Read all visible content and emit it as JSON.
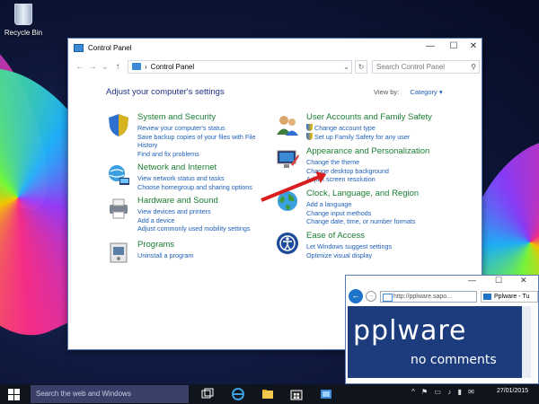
{
  "desktop": {
    "recycle_bin_label": "Recycle Bin"
  },
  "control_panel": {
    "window_title": "Control Panel",
    "address_path": "Control Panel",
    "search_placeholder": "Search Control Panel",
    "heading": "Adjust your computer's settings",
    "view_by_label": "View by:",
    "view_by_value": "Category",
    "categories": [
      {
        "title": "System and Security",
        "icon": "shield-icon",
        "links": [
          "Review your computer's status",
          "Save backup copies of your files with File History",
          "Find and fix problems"
        ]
      },
      {
        "title": "Network and Internet",
        "icon": "network-icon",
        "links": [
          "View network status and tasks",
          "Choose homegroup and sharing options"
        ]
      },
      {
        "title": "Hardware and Sound",
        "icon": "printer-icon",
        "links": [
          "View devices and printers",
          "Add a device",
          "Adjust commonly used mobility settings"
        ]
      },
      {
        "title": "Programs",
        "icon": "programs-icon",
        "links": [
          "Uninstall a program"
        ]
      },
      {
        "title": "User Accounts and Family Safety",
        "icon": "users-icon",
        "links": [
          "Change account type",
          "Set up Family Safety for any user"
        ]
      },
      {
        "title": "Appearance and Personalization",
        "icon": "display-icon",
        "links": [
          "Change the theme",
          "Change desktop background",
          "Adjust screen resolution"
        ]
      },
      {
        "title": "Clock, Language, and Region",
        "icon": "globe-icon",
        "links": [
          "Add a language",
          "Change input methods",
          "Change date, time, or number formats"
        ]
      },
      {
        "title": "Ease of Access",
        "icon": "ease-of-access-icon",
        "links": [
          "Let Windows suggest settings",
          "Optimize visual display"
        ]
      }
    ]
  },
  "browser": {
    "url": "http://pplware.sapo...",
    "tab_title": "Pplware - Tu",
    "banner_brand": "pplware",
    "banner_slogan": "no comments"
  },
  "taskbar": {
    "search_placeholder": "Search the web and Windows",
    "date": "27/01/2015"
  },
  "colors": {
    "link": "#1e5fba",
    "category_title": "#1a7d32",
    "heading": "#1e3287",
    "annotation_arrow": "#d81e1e"
  }
}
